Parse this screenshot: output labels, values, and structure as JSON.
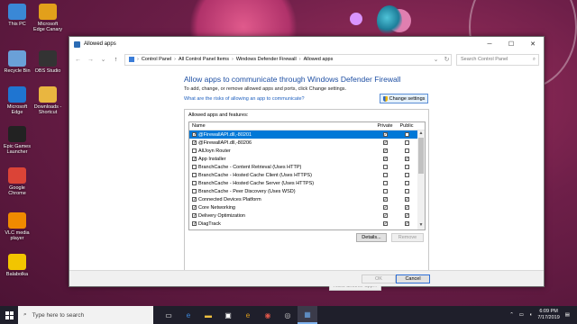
{
  "desktop": {
    "icons": [
      {
        "label": "This PC",
        "icon": "computer-icon",
        "color": "#3a88d6"
      },
      {
        "label": "Microsoft Edge Canary",
        "icon": "edge-canary-icon",
        "color": "#e2a01b"
      },
      {
        "label": "Recycle Bin",
        "icon": "recycle-bin-icon",
        "color": "#6aa0d8"
      },
      {
        "label": "OBS Studio",
        "icon": "obs-icon",
        "color": "#333333"
      },
      {
        "label": "Microsoft Edge",
        "icon": "edge-icon",
        "color": "#1f75d1"
      },
      {
        "label": "Downloads - Shortcut",
        "icon": "folder-icon",
        "color": "#e9b640"
      },
      {
        "label": "Epic Games Launcher",
        "icon": "epic-icon",
        "color": "#222222"
      },
      {
        "label": "Google Chrome",
        "icon": "chrome-icon",
        "color": "#db4437"
      },
      {
        "label": "VLC media player",
        "icon": "vlc-icon",
        "color": "#f08a00"
      },
      {
        "label": "Balabolka",
        "icon": "balabolka-icon",
        "color": "#f2c500"
      }
    ]
  },
  "window": {
    "title": "Allowed apps",
    "controls": {
      "minimize": "─",
      "maximize": "☐",
      "close": "✕"
    },
    "breadcrumbs": [
      "Control Panel",
      "All Control Panel Items",
      "Windows Defender Firewall",
      "Allowed apps"
    ],
    "search_placeholder": "Search Control Panel",
    "heading": "Allow apps to communicate through Windows Defender Firewall",
    "subtext": "To add, change, or remove allowed apps and ports, click Change settings.",
    "risk_link": "What are the risks of allowing an app to communicate?",
    "change_settings": "Change settings",
    "group_label": "Allowed apps and features:",
    "columns": {
      "name": "Name",
      "private": "Private",
      "public": "Public"
    },
    "rows": [
      {
        "checked": true,
        "name": "@FirewallAPI.dll,-80201",
        "private": true,
        "public": false,
        "selected": true
      },
      {
        "checked": true,
        "name": "@FirewallAPI.dll,-80206",
        "private": true,
        "public": false
      },
      {
        "checked": false,
        "name": "AllJoyn Router",
        "private": true,
        "public": false
      },
      {
        "checked": true,
        "name": "App Installer",
        "private": true,
        "public": true
      },
      {
        "checked": false,
        "name": "BranchCache - Content Retrieval (Uses HTTP)",
        "private": false,
        "public": false
      },
      {
        "checked": false,
        "name": "BranchCache - Hosted Cache Client (Uses HTTPS)",
        "private": false,
        "public": false
      },
      {
        "checked": false,
        "name": "BranchCache - Hosted Cache Server (Uses HTTPS)",
        "private": false,
        "public": false
      },
      {
        "checked": false,
        "name": "BranchCache - Peer Discovery (Uses WSD)",
        "private": false,
        "public": false
      },
      {
        "checked": true,
        "name": "Connected Devices Platform",
        "private": true,
        "public": true
      },
      {
        "checked": true,
        "name": "Core Networking",
        "private": true,
        "public": true
      },
      {
        "checked": true,
        "name": "Delivery Optimization",
        "private": true,
        "public": true
      },
      {
        "checked": true,
        "name": "DiagTrack",
        "private": true,
        "public": true
      }
    ],
    "details_button": "Details...",
    "remove_button": "Remove",
    "allow_another_button": "Allow another app...",
    "ok_button": "OK",
    "cancel_button": "Cancel"
  },
  "taskbar": {
    "search_text": "Type here to search",
    "apps": [
      "task-view-icon",
      "edge-icon",
      "file-explorer-icon",
      "store-icon",
      "edge-canary-icon",
      "chrome-icon",
      "obs-icon",
      "control-panel-icon"
    ],
    "time": "6:09 PM",
    "date": "7/17/2019"
  },
  "colors": {
    "accent": "#0078d7",
    "heading": "#1e4fa3",
    "link": "#1d5fbf"
  }
}
